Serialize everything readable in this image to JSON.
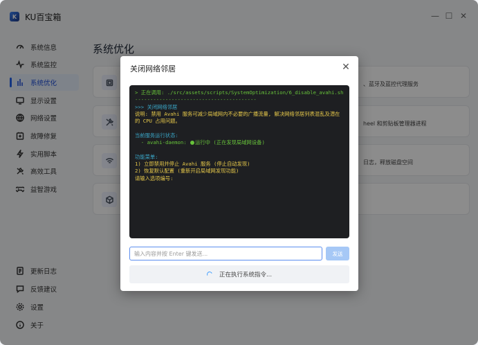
{
  "app": {
    "title": "KU百宝箱",
    "logo_icon": "app-logo-icon",
    "window_controls": [
      "minimize-icon",
      "maximize-icon",
      "close-icon"
    ]
  },
  "sidebar": {
    "items": [
      {
        "label": "系统信息",
        "icon": "dashboard-icon"
      },
      {
        "label": "系统监控",
        "icon": "pulse-icon"
      },
      {
        "label": "系统优化",
        "icon": "bars-icon",
        "active": true
      },
      {
        "label": "显示设置",
        "icon": "monitor-icon"
      },
      {
        "label": "网络设置",
        "icon": "globe-icon"
      },
      {
        "label": "故障修复",
        "icon": "wrench-icon"
      },
      {
        "label": "实用脚本",
        "icon": "bolt-icon"
      },
      {
        "label": "高效工具",
        "icon": "tools-icon"
      },
      {
        "label": "益智游戏",
        "icon": "gamepad-icon"
      }
    ],
    "bottom_items": [
      {
        "label": "更新日志",
        "icon": "document-icon"
      },
      {
        "label": "反馈建议",
        "icon": "chat-icon"
      },
      {
        "label": "设置",
        "icon": "gear-icon"
      },
      {
        "label": "关于",
        "icon": "info-icon"
      }
    ],
    "accent_color": "#2563eb"
  },
  "main": {
    "page_title": "系统优化",
    "cards": [
      {
        "icon": "chip-icon",
        "desc": "、蓝牙及蓝控代理服务"
      },
      {
        "icon": "tools-icon",
        "desc": "heel 和剪贴板管理器进程"
      },
      {
        "icon": "wifi-icon",
        "desc": "日志，释放磁盘空间"
      },
      {
        "icon": "cube-icon",
        "desc": ""
      }
    ]
  },
  "dialog": {
    "title": "关闭网络邻居",
    "terminal_lines": [
      {
        "text": "> 正在调用: ./src/assets/scripts/SystemOptimization/6_disable_avahi.sh",
        "color": "green"
      },
      {
        "text": "----------------------------------------",
        "color": "green"
      },
      {
        "text": ">>> 关闭网络邻居",
        "color": "cyan"
      },
      {
        "text": "说明: 禁用 Avahi 服务可减少局域网内不必要的广播流量, 解决网络邻居列表混乱及潜在的 CPU 占用问题。",
        "color": "yellow"
      },
      {
        "text": "",
        "color": "white"
      },
      {
        "text": "当前服务运行状态:",
        "color": "cyan"
      },
      {
        "text": "  - avahi-daemon: ",
        "color": "green",
        "status": "运行中 (正在发现局域网设备)"
      },
      {
        "text": "",
        "color": "white"
      },
      {
        "text": "功能菜单:",
        "color": "cyan"
      },
      {
        "text": "1) 立即禁用并停止 Avahi 服务 (停止自动发现)",
        "color": "yellow"
      },
      {
        "text": "2) 恢复默认配置 (重新开启局域网发现功能)",
        "color": "yellow"
      },
      {
        "text": "请输入选项编号:",
        "color": "yellow"
      }
    ],
    "input_placeholder": "输入内容并按 Enter 键发送...",
    "send_label": "发送",
    "status_text": "正在执行系统指令...",
    "close_icon": "close-icon"
  }
}
